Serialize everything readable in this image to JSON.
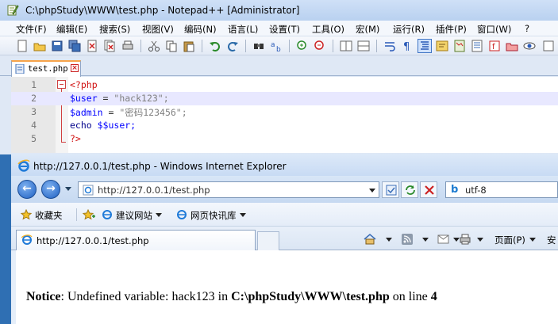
{
  "npp": {
    "title": "C:\\phpStudy\\WWW\\test.php - Notepad++ [Administrator]",
    "menu": [
      "文件(F)",
      "编辑(E)",
      "搜索(S)",
      "视图(V)",
      "编码(N)",
      "语言(L)",
      "设置(T)",
      "工具(O)",
      "宏(M)",
      "运行(R)",
      "插件(P)",
      "窗口(W)",
      "?"
    ],
    "tab_label": "test.php",
    "line_numbers": [
      "1",
      "2",
      "3",
      "4",
      "5"
    ],
    "code": {
      "l1_tag": "<?php",
      "l2_var": "$user",
      "l2_eq": " = ",
      "l2_str": "\"hack123\";",
      "l3_var": "$admin",
      "l3_eq": " = ",
      "l3_str": "\"密码123456\";",
      "l4_kw": "echo",
      "l4_var": " $$user;",
      "l5_tag": "?>"
    }
  },
  "ie": {
    "title": "http://127.0.0.1/test.php - Windows Internet Explorer",
    "address": "http://127.0.0.1/test.php",
    "search_text": "utf-8",
    "favorites": "收藏夹",
    "fav_links": [
      "建议网站",
      "网页快讯库"
    ],
    "tab_title": "http://127.0.0.1/test.php",
    "page_menu": "页面(P)",
    "safety_menu": "安",
    "notice": {
      "label": "Notice",
      "message": ": Undefined variable: hack123 in ",
      "path": "C:\\phpStudy\\WWW\\test.php",
      "on_line": " on line ",
      "line": "4"
    }
  },
  "colors": {
    "php_tag": "#d01010",
    "variable": "#0000ff",
    "string": "#808080",
    "current_line": "#e8e8ff",
    "tab_accent": "#f7a44a"
  }
}
